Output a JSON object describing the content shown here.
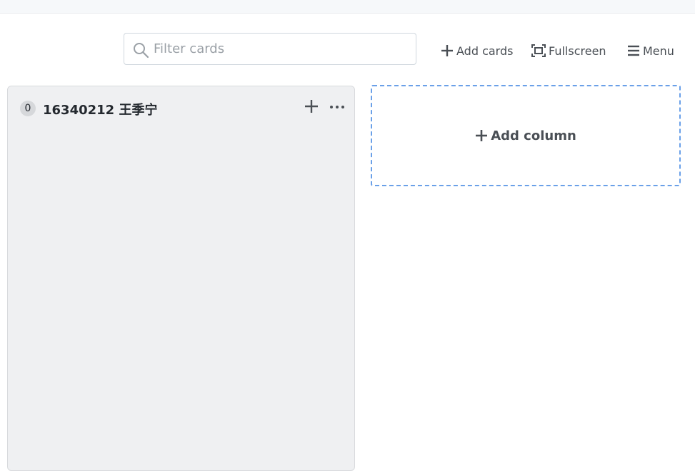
{
  "filter": {
    "placeholder": "Filter cards",
    "value": ""
  },
  "toolbar": {
    "add_cards_label": "Add cards",
    "fullscreen_label": "Fullscreen",
    "menu_label": "Menu"
  },
  "columns": [
    {
      "count": "0",
      "title": "16340212 王季宁"
    }
  ],
  "add_column": {
    "label": "Add column"
  },
  "icons": {
    "search": "search-icon",
    "plus": "plus-icon",
    "fullscreen": "fullscreen-icon",
    "menu": "hamburger-icon",
    "more": "more-horizontal-icon"
  },
  "colors": {
    "column_bg": "#eff0f2",
    "add_column_border": "#6aa0e8",
    "text": "#24292f",
    "muted_text": "#4a4f55"
  }
}
